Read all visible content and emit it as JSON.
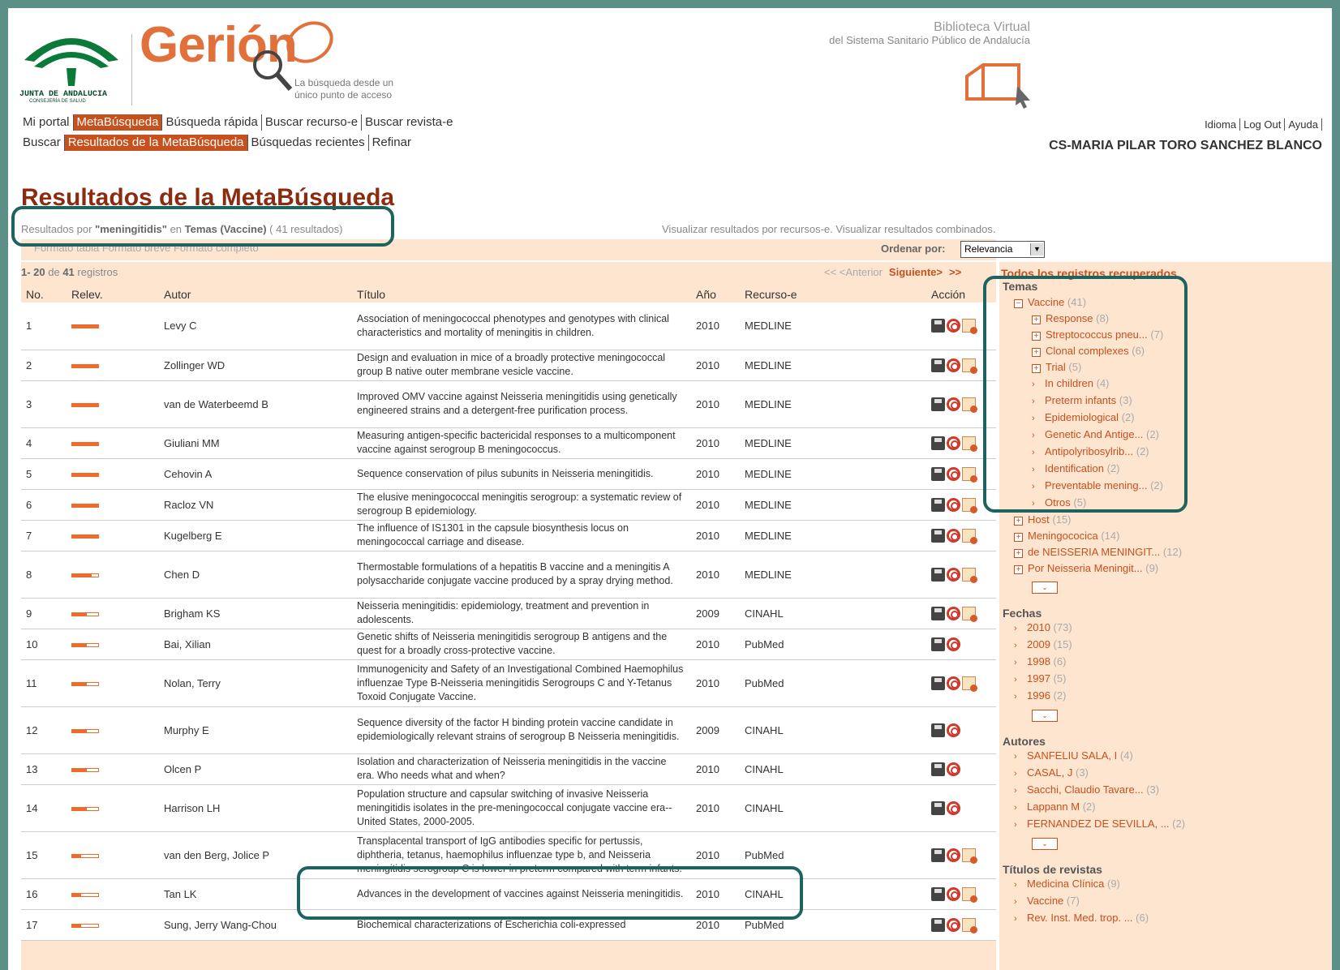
{
  "header": {
    "logo_ja": {
      "line1": "JUNTA DE ANDALUCIA",
      "line2": "CONSEJERÍA DE SALUD"
    },
    "brand": "Gerión",
    "tagline": [
      "La búsqueda desde un",
      "único punto de acceso"
    ],
    "biblioteca": [
      "Biblioteca Virtual",
      "del Sistema Sanitario Público de Andalucía"
    ]
  },
  "nav1": [
    "Mi portal",
    "MetaBúsqueda",
    "Búsqueda rápida",
    "Buscar recurso-e",
    "Buscar revista-e"
  ],
  "nav2": [
    "Buscar",
    "Resultados de la MetaBúsqueda",
    "Búsquedas recientes",
    "Refinar"
  ],
  "util": [
    "Idioma",
    "Log Out",
    "Ayuda"
  ],
  "user": "CS-MARIA PILAR TORO SANCHEZ BLANCO",
  "page_title": "Resultados de la MetaBúsqueda",
  "summary": {
    "p1": "Resultados por ",
    "query": "\"meningitidis\"",
    "p2": " en ",
    "topic": "Temas (Vaccine)",
    "count": " ( 41 resultados)"
  },
  "visualize": {
    "p1": "Visualizar ",
    "l1": "resultados por recursos-e",
    "p2": ". Visualizar ",
    "l2": "resultados combinados",
    "p3": "."
  },
  "formats": "Formato tabla  Formato breve  Formato completo",
  "order": {
    "label": "Ordenar por:",
    "value": "Relevancia"
  },
  "records": {
    "range": "1- 20",
    "of": " de ",
    "total": "41",
    "suffix": " registros"
  },
  "pager": {
    "prev": "<< <Anterior",
    "next": "Siguiente>",
    "last": ">>"
  },
  "columns": [
    "No.",
    "Relev.",
    "Autor",
    "Título",
    "Año",
    "Recurso-e",
    "Acción"
  ],
  "rows": [
    {
      "no": "1",
      "rel": 1.0,
      "author": "Levy C",
      "title": "Association of meningococcal phenotypes and genotypes with clinical characteristics and mortality of meningitis in children.",
      "year": "2010",
      "src": "MEDLINE",
      "doc": true
    },
    {
      "no": "2",
      "rel": 1.0,
      "author": "Zollinger WD",
      "title": "Design and evaluation in mice of a broadly protective meningococcal group B native outer membrane vesicle vaccine.",
      "year": "2010",
      "src": "MEDLINE",
      "doc": true
    },
    {
      "no": "3",
      "rel": 1.0,
      "author": "van de Waterbeemd B",
      "title": "Improved OMV vaccine against Neisseria meningitidis using genetically engineered strains and a detergent-free purification process.",
      "year": "2010",
      "src": "MEDLINE",
      "doc": true
    },
    {
      "no": "4",
      "rel": 1.0,
      "author": "Giuliani MM",
      "title": "Measuring antigen-specific bactericidal responses to a multicomponent vaccine against serogroup B meningococcus.",
      "year": "2010",
      "src": "MEDLINE",
      "doc": true
    },
    {
      "no": "5",
      "rel": 1.0,
      "author": "Cehovin A",
      "title": "Sequence conservation of pilus subunits in Neisseria meningitidis.",
      "year": "2010",
      "src": "MEDLINE",
      "doc": true
    },
    {
      "no": "6",
      "rel": 1.0,
      "author": "Racloz VN",
      "title": "The elusive meningococcal meningitis serogroup: a systematic review of serogroup B epidemiology.",
      "year": "2010",
      "src": "MEDLINE",
      "doc": true
    },
    {
      "no": "7",
      "rel": 1.0,
      "author": "Kugelberg E",
      "title": "The influence of IS1301 in the capsule biosynthesis locus on meningococcal carriage and disease.",
      "year": "2010",
      "src": "MEDLINE",
      "doc": true
    },
    {
      "no": "8",
      "rel": 0.75,
      "author": "Chen D",
      "title": "Thermostable formulations of a hepatitis B vaccine and a meningitis A polysaccharide conjugate vaccine produced by a spray drying method.",
      "year": "2010",
      "src": "MEDLINE",
      "doc": true
    },
    {
      "no": "9",
      "rel": 0.55,
      "author": "Brigham KS",
      "title": "Neisseria meningitidis: epidemiology, treatment and prevention in adolescents.",
      "year": "2009",
      "src": "CINAHL",
      "doc": true
    },
    {
      "no": "10",
      "rel": 0.55,
      "author": "Bai, Xilian",
      "title": "Genetic shifts of Neisseria meningitidis serogroup B antigens and the quest for a broadly cross-protective vaccine.",
      "year": "2010",
      "src": "PubMed",
      "doc": false
    },
    {
      "no": "11",
      "rel": 0.55,
      "author": "Nolan, Terry",
      "title": "Immunogenicity and Safety of an Investigational Combined Haemophilus influenzae Type B-Neisseria meningitidis Serogroups C and Y-Tetanus Toxoid Conjugate Vaccine.",
      "year": "2010",
      "src": "PubMed",
      "doc": true
    },
    {
      "no": "12",
      "rel": 0.55,
      "author": "Murphy E",
      "title": "Sequence diversity of the factor H binding protein vaccine candidate in epidemiologically relevant strains of serogroup B Neisseria meningitidis.",
      "year": "2009",
      "src": "CINAHL",
      "doc": false
    },
    {
      "no": "13",
      "rel": 0.55,
      "author": "Olcen P",
      "title": "Isolation and characterization of Neisseria meningitidis in the vaccine era. Who needs what and when?",
      "year": "2010",
      "src": "CINAHL",
      "doc": false
    },
    {
      "no": "14",
      "rel": 0.55,
      "author": "Harrison LH",
      "title": "Population structure and capsular switching of invasive Neisseria meningitidis isolates in the pre-meningococcal conjugate vaccine era--United States, 2000-2005.",
      "year": "2010",
      "src": "CINAHL",
      "doc": false
    },
    {
      "no": "15",
      "rel": 0.35,
      "author": "van den Berg, Jolice P",
      "title": "Transplacental transport of IgG antibodies specific for pertussis, diphtheria, tetanus, haemophilus influenzae type b, and Neisseria meningitidis serogroup C is lower in preterm compared with term infants.",
      "year": "2010",
      "src": "PubMed",
      "doc": true
    },
    {
      "no": "16",
      "rel": 0.35,
      "author": "Tan LK",
      "title": "Advances in the development of vaccines against Neisseria meningitidis.",
      "year": "2010",
      "src": "CINAHL",
      "doc": true
    },
    {
      "no": "17",
      "rel": 0.35,
      "author": "Sung, Jerry Wang-Chou",
      "title": "Biochemical characterizations of Escherichia coli-expressed",
      "year": "2010",
      "src": "PubMed",
      "doc": true
    }
  ],
  "sidebar": {
    "all_link": "Todos los registros recuperados",
    "temas": {
      "heading": "Temas",
      "root": {
        "label": "Vaccine",
        "count": "(41)"
      },
      "children": [
        {
          "t": "plus",
          "label": "Response",
          "count": "(8)"
        },
        {
          "t": "plus",
          "label": "Streptococcus pneu...",
          "count": "(7)"
        },
        {
          "t": "plus",
          "label": "Clonal complexes",
          "count": "(6)"
        },
        {
          "t": "plus",
          "label": "Trial",
          "count": "(5)"
        },
        {
          "t": "arrow",
          "label": "In children",
          "count": "(4)"
        },
        {
          "t": "arrow",
          "label": "Preterm infants",
          "count": "(3)"
        },
        {
          "t": "arrow",
          "label": "Epidemiological",
          "count": "(2)"
        },
        {
          "t": "arrow",
          "label": "Genetic And Antige...",
          "count": "(2)"
        },
        {
          "t": "arrow",
          "label": "Antipolyribosylrib...",
          "count": "(2)"
        },
        {
          "t": "arrow",
          "label": "Identification",
          "count": "(2)"
        },
        {
          "t": "arrow",
          "label": "Preventable mening...",
          "count": "(2)"
        },
        {
          "t": "arrow",
          "label": "Otros",
          "count": "(5)"
        }
      ],
      "siblings": [
        {
          "label": "Host",
          "count": "(15)"
        },
        {
          "label": "Meningococica",
          "count": "(14)"
        },
        {
          "label": "de NEISSERIA MENINGIT...",
          "count": "(12)"
        },
        {
          "label": "Por Neisseria Meningit...",
          "count": "(9)"
        }
      ]
    },
    "fechas": {
      "heading": "Fechas",
      "items": [
        {
          "label": "2010",
          "count": "(73)"
        },
        {
          "label": "2009",
          "count": "(15)"
        },
        {
          "label": "1998",
          "count": "(6)"
        },
        {
          "label": "1997",
          "count": "(5)"
        },
        {
          "label": "1996",
          "count": "(2)"
        }
      ]
    },
    "autores": {
      "heading": "Autores",
      "items": [
        {
          "label": "SANFELIU SALA, I",
          "count": "(4)"
        },
        {
          "label": "CASAL, J",
          "count": "(3)"
        },
        {
          "label": "Sacchi, Claudio Tavare...",
          "count": "(3)"
        },
        {
          "label": "Lappann M",
          "count": "(2)"
        },
        {
          "label": "FERNANDEZ DE SEVILLA, ...",
          "count": "(2)"
        }
      ]
    },
    "revistas": {
      "heading": "Títulos de revistas",
      "items": [
        {
          "label": "Medicina Clínica",
          "count": "(9)"
        },
        {
          "label": "Vaccine",
          "count": "(7)"
        },
        {
          "label": "Rev. Inst. Med. trop. ...",
          "count": "(6)"
        }
      ]
    }
  },
  "colors": {
    "accent": "#c8501c",
    "title": "#8b2b10",
    "panel": "#fde5d0",
    "highlight": "#1f6360",
    "frame": "#5b8f88"
  }
}
